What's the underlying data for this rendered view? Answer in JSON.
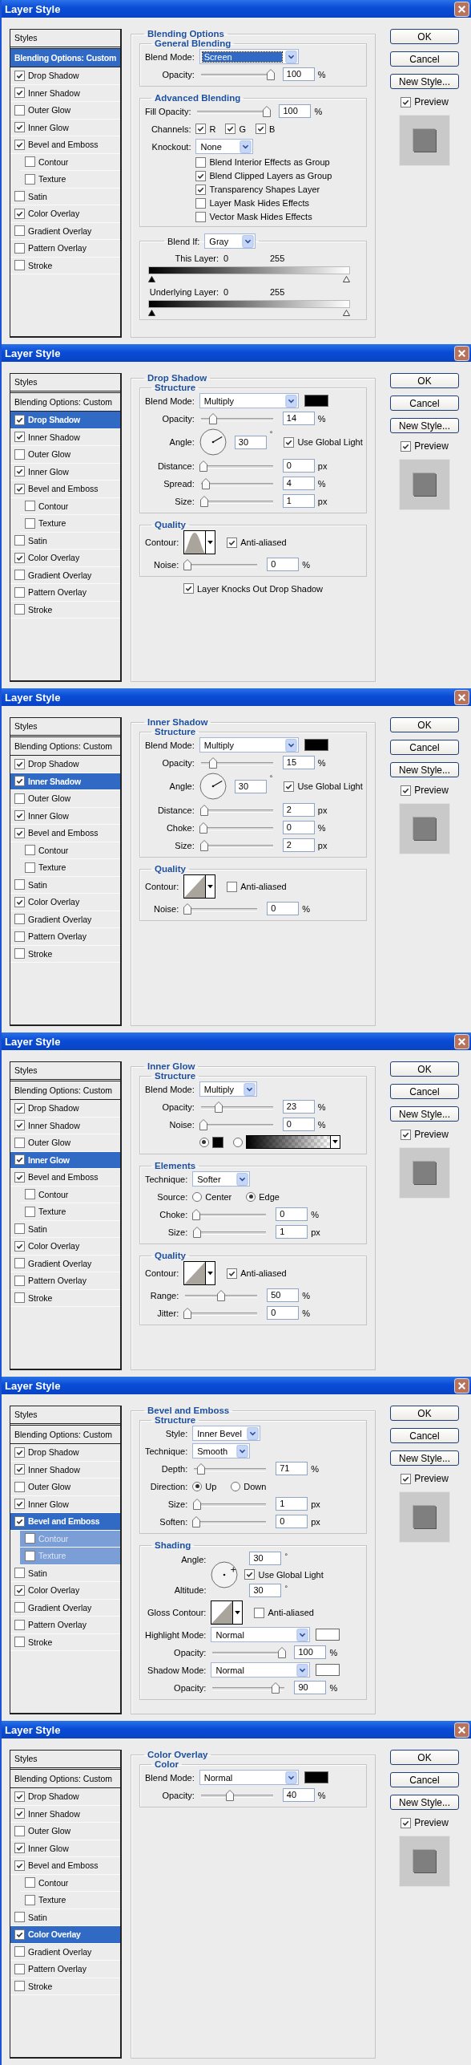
{
  "dialogs": [
    {
      "title": "Layer Style",
      "sidebar": {
        "header": "Styles",
        "items": [
          {
            "label": "Blending Options: Custom",
            "kind": "option",
            "selected": true
          },
          {
            "label": "Drop Shadow",
            "kind": "effect",
            "checked": true,
            "selected": false
          },
          {
            "label": "Inner Shadow",
            "kind": "effect",
            "checked": true,
            "selected": false
          },
          {
            "label": "Outer Glow",
            "kind": "effect",
            "checked": false,
            "selected": false
          },
          {
            "label": "Inner Glow",
            "kind": "effect",
            "checked": true,
            "selected": false
          },
          {
            "label": "Bevel and Emboss",
            "kind": "effect",
            "checked": true,
            "selected": false,
            "children": [
              {
                "label": "Contour",
                "kind": "effect",
                "checked": false,
                "selected": false
              },
              {
                "label": "Texture",
                "kind": "effect",
                "checked": false,
                "selected": false
              }
            ]
          },
          {
            "label": "Satin",
            "kind": "effect",
            "checked": false,
            "selected": false
          },
          {
            "label": "Color Overlay",
            "kind": "effect",
            "checked": true,
            "selected": false
          },
          {
            "label": "Gradient Overlay",
            "kind": "effect",
            "checked": false,
            "selected": false
          },
          {
            "label": "Pattern Overlay",
            "kind": "effect",
            "checked": false,
            "selected": false
          },
          {
            "label": "Stroke",
            "kind": "effect",
            "checked": false,
            "selected": false
          }
        ]
      },
      "panel": {
        "title": "Blending Options",
        "groups": [
          {
            "kind": "fields",
            "title": "General Blending",
            "rows": [
              {
                "kind": "select",
                "label": "Blend Mode:",
                "value": "Screen",
                "focused": true
              },
              {
                "kind": "slider",
                "label": "Opacity:",
                "level": 1,
                "value": "100",
                "unit": "%"
              }
            ]
          },
          {
            "kind": "fields",
            "title": "Advanced Blending",
            "rows": [
              {
                "kind": "slider",
                "label": "Fill Opacity:",
                "level": 1,
                "value": "100",
                "unit": "%"
              },
              {
                "kind": "checks",
                "label": "Channels:",
                "items": [
                  {
                    "label": "R",
                    "checked": true
                  },
                  {
                    "label": "G",
                    "checked": true
                  },
                  {
                    "label": "B",
                    "checked": true
                  }
                ]
              },
              {
                "kind": "select",
                "label": "Knockout:",
                "value": "None"
              },
              {
                "kind": "checkbox",
                "label": "Blend Interior Effects as Group",
                "checked": false
              },
              {
                "kind": "checkbox",
                "label": "Blend Clipped Layers as Group",
                "checked": true
              },
              {
                "kind": "checkbox",
                "label": "Transparency Shapes Layer",
                "checked": true
              },
              {
                "kind": "checkbox",
                "label": "Layer Mask Hides Effects",
                "checked": false
              },
              {
                "kind": "checkbox",
                "label": "Vector Mask Hides Effects",
                "checked": false
              }
            ]
          },
          {
            "kind": "blendif",
            "label": "Blend If:",
            "value": "Gray",
            "layers": [
              {
                "label": "This Layer:",
                "low": "0",
                "high": "255"
              },
              {
                "label": "Underlying Layer:",
                "low": "0",
                "high": "255"
              }
            ]
          }
        ]
      },
      "buttons": [
        {
          "label": "OK"
        },
        {
          "label": "Cancel"
        },
        {
          "label": "New Style..."
        }
      ],
      "preview": {
        "label": "Preview",
        "checked": true
      }
    },
    {
      "title": "Layer Style",
      "sidebar": {
        "header": "Styles",
        "items": [
          {
            "label": "Blending Options: Custom",
            "kind": "option",
            "selected": false
          },
          {
            "label": "Drop Shadow",
            "kind": "effect",
            "checked": true,
            "selected": true
          },
          {
            "label": "Inner Shadow",
            "kind": "effect",
            "checked": true,
            "selected": false
          },
          {
            "label": "Outer Glow",
            "kind": "effect",
            "checked": false,
            "selected": false
          },
          {
            "label": "Inner Glow",
            "kind": "effect",
            "checked": true,
            "selected": false
          },
          {
            "label": "Bevel and Emboss",
            "kind": "effect",
            "checked": true,
            "selected": false,
            "children": [
              {
                "label": "Contour",
                "kind": "effect",
                "checked": false,
                "selected": false
              },
              {
                "label": "Texture",
                "kind": "effect",
                "checked": false,
                "selected": false
              }
            ]
          },
          {
            "label": "Satin",
            "kind": "effect",
            "checked": false,
            "selected": false
          },
          {
            "label": "Color Overlay",
            "kind": "effect",
            "checked": true,
            "selected": false
          },
          {
            "label": "Gradient Overlay",
            "kind": "effect",
            "checked": false,
            "selected": false
          },
          {
            "label": "Pattern Overlay",
            "kind": "effect",
            "checked": false,
            "selected": false
          },
          {
            "label": "Stroke",
            "kind": "effect",
            "checked": false,
            "selected": false
          }
        ]
      },
      "panel": {
        "title": "Drop Shadow",
        "groups": [
          {
            "kind": "fields",
            "title": "Structure",
            "rows": [
              {
                "kind": "select",
                "label": "Blend Mode:",
                "value": "Multiply",
                "color": "#000000"
              },
              {
                "kind": "slider",
                "label": "Opacity:",
                "level": 0.14,
                "value": "14",
                "unit": "%"
              },
              {
                "kind": "angle",
                "label": "Angle:",
                "value": "30",
                "unit": "°",
                "option": {
                  "label": "Use Global Light",
                  "checked": true
                }
              },
              {
                "kind": "slider",
                "label": "Distance:",
                "level": 0,
                "value": "0",
                "unit": "px"
              },
              {
                "kind": "slider",
                "label": "Spread:",
                "level": 0.04,
                "value": "4",
                "unit": "%"
              },
              {
                "kind": "slider",
                "label": "Size:",
                "level": 0.01,
                "value": "1",
                "unit": "px"
              }
            ]
          },
          {
            "kind": "fields",
            "title": "Quality",
            "rows": [
              {
                "kind": "contour",
                "label": "Contour:",
                "curve": {
                  "kind": "peak"
                },
                "option": {
                  "label": "Anti-aliased",
                  "checked": true
                }
              },
              {
                "kind": "slider",
                "label": "Noise:",
                "level": 0,
                "value": "0",
                "unit": "%"
              }
            ]
          }
        ],
        "footer": {
          "label": "Layer Knocks Out Drop Shadow",
          "checked": true
        }
      },
      "buttons": [
        {
          "label": "OK"
        },
        {
          "label": "Cancel"
        },
        {
          "label": "New Style..."
        }
      ],
      "preview": {
        "label": "Preview",
        "checked": true
      }
    },
    {
      "title": "Layer Style",
      "sidebar": {
        "header": "Styles",
        "items": [
          {
            "label": "Blending Options: Custom",
            "kind": "option",
            "selected": false
          },
          {
            "label": "Drop Shadow",
            "kind": "effect",
            "checked": true,
            "selected": false
          },
          {
            "label": "Inner Shadow",
            "kind": "effect",
            "checked": true,
            "selected": true
          },
          {
            "label": "Outer Glow",
            "kind": "effect",
            "checked": false,
            "selected": false
          },
          {
            "label": "Inner Glow",
            "kind": "effect",
            "checked": true,
            "selected": false
          },
          {
            "label": "Bevel and Emboss",
            "kind": "effect",
            "checked": true,
            "selected": false,
            "children": [
              {
                "label": "Contour",
                "kind": "effect",
                "checked": false,
                "selected": false
              },
              {
                "label": "Texture",
                "kind": "effect",
                "checked": false,
                "selected": false
              }
            ]
          },
          {
            "label": "Satin",
            "kind": "effect",
            "checked": false,
            "selected": false
          },
          {
            "label": "Color Overlay",
            "kind": "effect",
            "checked": true,
            "selected": false
          },
          {
            "label": "Gradient Overlay",
            "kind": "effect",
            "checked": false,
            "selected": false
          },
          {
            "label": "Pattern Overlay",
            "kind": "effect",
            "checked": false,
            "selected": false
          },
          {
            "label": "Stroke",
            "kind": "effect",
            "checked": false,
            "selected": false
          }
        ]
      },
      "panel": {
        "title": "Inner Shadow",
        "groups": [
          {
            "kind": "fields",
            "title": "Structure",
            "rows": [
              {
                "kind": "select",
                "label": "Blend Mode:",
                "value": "Multiply",
                "color": "#000000"
              },
              {
                "kind": "slider",
                "label": "Opacity:",
                "level": 0.15,
                "value": "15",
                "unit": "%"
              },
              {
                "kind": "angle",
                "label": "Angle:",
                "value": "30",
                "unit": "°",
                "option": {
                  "label": "Use Global Light",
                  "checked": true
                }
              },
              {
                "kind": "slider",
                "label": "Distance:",
                "level": 0.02,
                "value": "2",
                "unit": "px"
              },
              {
                "kind": "slider",
                "label": "Choke:",
                "level": 0,
                "value": "0",
                "unit": "%"
              },
              {
                "kind": "slider",
                "label": "Size:",
                "level": 0.02,
                "value": "2",
                "unit": "px"
              }
            ]
          },
          {
            "kind": "fields",
            "title": "Quality",
            "rows": [
              {
                "kind": "contour",
                "label": "Contour:",
                "curve": {
                  "kind": "linear"
                },
                "option": {
                  "label": "Anti-aliased",
                  "checked": false
                }
              },
              {
                "kind": "slider",
                "label": "Noise:",
                "level": 0,
                "value": "0",
                "unit": "%"
              }
            ]
          }
        ]
      },
      "buttons": [
        {
          "label": "OK"
        },
        {
          "label": "Cancel"
        },
        {
          "label": "New Style..."
        }
      ],
      "preview": {
        "label": "Preview",
        "checked": true
      }
    },
    {
      "title": "Layer Style",
      "sidebar": {
        "header": "Styles",
        "items": [
          {
            "label": "Blending Options: Custom",
            "kind": "option",
            "selected": false
          },
          {
            "label": "Drop Shadow",
            "kind": "effect",
            "checked": true,
            "selected": false
          },
          {
            "label": "Inner Shadow",
            "kind": "effect",
            "checked": true,
            "selected": false
          },
          {
            "label": "Outer Glow",
            "kind": "effect",
            "checked": false,
            "selected": false
          },
          {
            "label": "Inner Glow",
            "kind": "effect",
            "checked": true,
            "selected": true
          },
          {
            "label": "Bevel and Emboss",
            "kind": "effect",
            "checked": true,
            "selected": false,
            "children": [
              {
                "label": "Contour",
                "kind": "effect",
                "checked": false,
                "selected": false
              },
              {
                "label": "Texture",
                "kind": "effect",
                "checked": false,
                "selected": false
              }
            ]
          },
          {
            "label": "Satin",
            "kind": "effect",
            "checked": false,
            "selected": false
          },
          {
            "label": "Color Overlay",
            "kind": "effect",
            "checked": true,
            "selected": false
          },
          {
            "label": "Gradient Overlay",
            "kind": "effect",
            "checked": false,
            "selected": false
          },
          {
            "label": "Pattern Overlay",
            "kind": "effect",
            "checked": false,
            "selected": false
          },
          {
            "label": "Stroke",
            "kind": "effect",
            "checked": false,
            "selected": false
          }
        ]
      },
      "panel": {
        "title": "Inner Glow",
        "groups": [
          {
            "kind": "fields",
            "title": "Structure",
            "rows": [
              {
                "kind": "select",
                "label": "Blend Mode:",
                "value": "Multiply"
              },
              {
                "kind": "slider",
                "label": "Opacity:",
                "level": 0.23,
                "value": "23",
                "unit": "%"
              },
              {
                "kind": "slider",
                "label": "Noise:",
                "level": 0,
                "value": "0",
                "unit": "%"
              },
              {
                "kind": "fill",
                "options": [
                  {
                    "kind": "swatch",
                    "selected": true,
                    "color": "#000000"
                  },
                  {
                    "kind": "gradient",
                    "selected": false
                  }
                ]
              }
            ]
          },
          {
            "kind": "fields",
            "title": "Elements",
            "rows": [
              {
                "kind": "select",
                "label": "Technique:",
                "value": "Softer"
              },
              {
                "kind": "radio",
                "label": "Source:",
                "options": [
                  {
                    "label": "Center",
                    "selected": false
                  },
                  {
                    "label": "Edge",
                    "selected": true
                  }
                ]
              },
              {
                "kind": "slider",
                "label": "Choke:",
                "level": 0,
                "value": "0",
                "unit": "%"
              },
              {
                "kind": "slider",
                "label": "Size:",
                "level": 0.01,
                "value": "1",
                "unit": "px"
              }
            ]
          },
          {
            "kind": "fields",
            "title": "Quality",
            "rows": [
              {
                "kind": "contour",
                "label": "Contour:",
                "curve": {
                  "kind": "linear"
                },
                "option": {
                  "label": "Anti-aliased",
                  "checked": true
                }
              },
              {
                "kind": "slider",
                "label": "Range:",
                "level": 0.5,
                "value": "50",
                "unit": "%"
              },
              {
                "kind": "slider",
                "label": "Jitter:",
                "level": 0,
                "value": "0",
                "unit": "%"
              }
            ]
          }
        ]
      },
      "buttons": [
        {
          "label": "OK"
        },
        {
          "label": "Cancel"
        },
        {
          "label": "New Style..."
        }
      ],
      "preview": {
        "label": "Preview",
        "checked": true
      }
    },
    {
      "title": "Layer Style",
      "sidebar": {
        "header": "Styles",
        "items": [
          {
            "label": "Blending Options: Custom",
            "kind": "option",
            "selected": false
          },
          {
            "label": "Drop Shadow",
            "kind": "effect",
            "checked": true,
            "selected": false
          },
          {
            "label": "Inner Shadow",
            "kind": "effect",
            "checked": true,
            "selected": false
          },
          {
            "label": "Outer Glow",
            "kind": "effect",
            "checked": false,
            "selected": false
          },
          {
            "label": "Inner Glow",
            "kind": "effect",
            "checked": true,
            "selected": false
          },
          {
            "label": "Bevel and Emboss",
            "kind": "effect",
            "checked": true,
            "selected": true,
            "children": [
              {
                "label": "Contour",
                "kind": "effect",
                "checked": false,
                "selected": false
              },
              {
                "label": "Texture",
                "kind": "effect",
                "checked": false,
                "selected": false
              }
            ]
          },
          {
            "label": "Satin",
            "kind": "effect",
            "checked": false,
            "selected": false
          },
          {
            "label": "Color Overlay",
            "kind": "effect",
            "checked": true,
            "selected": false
          },
          {
            "label": "Gradient Overlay",
            "kind": "effect",
            "checked": false,
            "selected": false
          },
          {
            "label": "Pattern Overlay",
            "kind": "effect",
            "checked": false,
            "selected": false
          },
          {
            "label": "Stroke",
            "kind": "effect",
            "checked": false,
            "selected": false
          }
        ]
      },
      "panel": {
        "title": "Bevel and Emboss",
        "groups": [
          {
            "kind": "fields",
            "title": "Structure",
            "rows": [
              {
                "kind": "select",
                "label": "Style:",
                "value": "Inner Bevel"
              },
              {
                "kind": "select",
                "label": "Technique:",
                "value": "Smooth"
              },
              {
                "kind": "slider",
                "label": "Depth:",
                "level": 0.07,
                "value": "71",
                "unit": "%"
              },
              {
                "kind": "radio",
                "label": "Direction:",
                "options": [
                  {
                    "label": "Up",
                    "selected": true
                  },
                  {
                    "label": "Down",
                    "selected": false
                  }
                ]
              },
              {
                "kind": "slider",
                "label": "Size:",
                "level": 0.01,
                "value": "1",
                "unit": "px"
              },
              {
                "kind": "slider",
                "label": "Soften:",
                "level": 0,
                "value": "0",
                "unit": "px"
              }
            ]
          },
          {
            "kind": "fields",
            "title": "Shading",
            "rows": [
              {
                "kind": "shading",
                "angle": {
                  "label": "Angle:",
                  "value": "30",
                  "unit": "°"
                },
                "option": {
                  "label": "Use Global Light",
                  "checked": true
                },
                "altitude": {
                  "label": "Altitude:",
                  "value": "30",
                  "unit": "°"
                }
              },
              {
                "kind": "contour",
                "label": "Gloss Contour:",
                "curve": {
                  "kind": "linear"
                },
                "option": {
                  "label": "Anti-aliased",
                  "checked": false
                }
              },
              {
                "kind": "select",
                "label": "Highlight Mode:",
                "value": "Normal",
                "color": "#ffffff"
              },
              {
                "kind": "slider",
                "label": "Opacity:",
                "level": 1,
                "value": "100",
                "unit": "%"
              },
              {
                "kind": "select",
                "label": "Shadow Mode:",
                "value": "Normal",
                "color": "#ffffff"
              },
              {
                "kind": "slider",
                "label": "Opacity:",
                "level": 0.9,
                "value": "90",
                "unit": "%"
              }
            ]
          }
        ]
      },
      "buttons": [
        {
          "label": "OK"
        },
        {
          "label": "Cancel"
        },
        {
          "label": "New Style..."
        }
      ],
      "preview": {
        "label": "Preview",
        "checked": true
      }
    },
    {
      "title": "Layer Style",
      "sidebar": {
        "header": "Styles",
        "items": [
          {
            "label": "Blending Options: Custom",
            "kind": "option",
            "selected": false
          },
          {
            "label": "Drop Shadow",
            "kind": "effect",
            "checked": true,
            "selected": false
          },
          {
            "label": "Inner Shadow",
            "kind": "effect",
            "checked": true,
            "selected": false
          },
          {
            "label": "Outer Glow",
            "kind": "effect",
            "checked": false,
            "selected": false
          },
          {
            "label": "Inner Glow",
            "kind": "effect",
            "checked": true,
            "selected": false
          },
          {
            "label": "Bevel and Emboss",
            "kind": "effect",
            "checked": true,
            "selected": false,
            "children": [
              {
                "label": "Contour",
                "kind": "effect",
                "checked": false,
                "selected": false
              },
              {
                "label": "Texture",
                "kind": "effect",
                "checked": false,
                "selected": false
              }
            ]
          },
          {
            "label": "Satin",
            "kind": "effect",
            "checked": false,
            "selected": false
          },
          {
            "label": "Color Overlay",
            "kind": "effect",
            "checked": true,
            "selected": true
          },
          {
            "label": "Gradient Overlay",
            "kind": "effect",
            "checked": false,
            "selected": false
          },
          {
            "label": "Pattern Overlay",
            "kind": "effect",
            "checked": false,
            "selected": false
          },
          {
            "label": "Stroke",
            "kind": "effect",
            "checked": false,
            "selected": false
          }
        ]
      },
      "panel": {
        "title": "Color Overlay",
        "groups": [
          {
            "kind": "fields",
            "title": "Color",
            "rows": [
              {
                "kind": "select",
                "label": "Blend Mode:",
                "value": "Normal",
                "color": "#000000"
              },
              {
                "kind": "slider",
                "label": "Opacity:",
                "level": 0.4,
                "value": "40",
                "unit": "%"
              }
            ]
          }
        ]
      },
      "buttons": [
        {
          "label": "OK"
        },
        {
          "label": "Cancel"
        },
        {
          "label": "New Style..."
        }
      ],
      "preview": {
        "label": "Preview",
        "checked": true
      }
    }
  ]
}
